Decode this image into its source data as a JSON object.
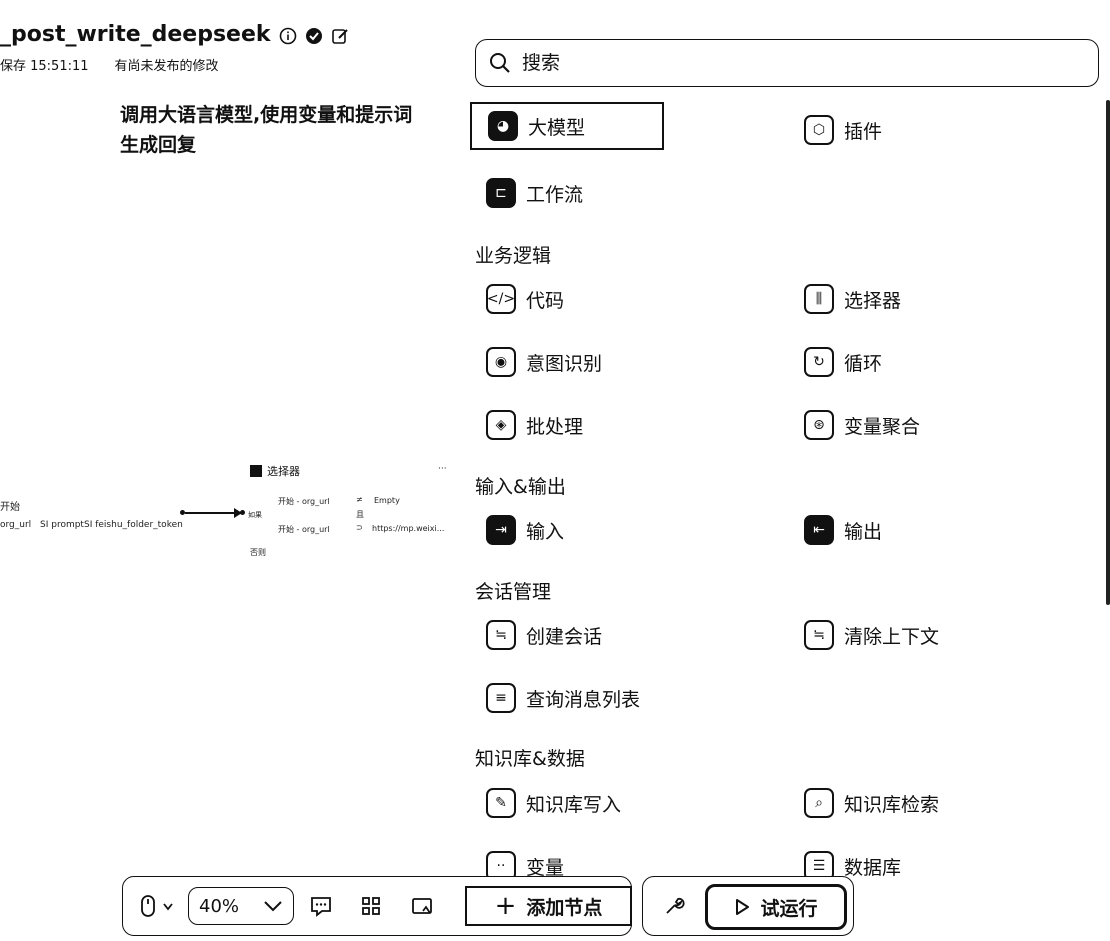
{
  "header": {
    "title": "_post_write_deepseek",
    "save_status": "保存 15:51:11",
    "unpublished": "有尚未发布的修改"
  },
  "tooltip": {
    "line1": "调用大语言模型,使用变量和提示词",
    "line2": "生成回复"
  },
  "canvas": {
    "start_label": "开始",
    "start_vars": [
      "org_url",
      "SI prompt",
      "SI feishu_folder_token"
    ],
    "selector_title": "选择器",
    "selector_if": "开始 - org_url",
    "selector_is_empty": "Empty",
    "selector_else_label": "否则",
    "selector_else": "开始 - org_url",
    "selector_compare": "https://mp.weixi...",
    "selector_side_marks": [
      "≠",
      "且",
      "⊃"
    ],
    "selector_more": "···",
    "port_label": "如果",
    "else_port": "否则"
  },
  "search": {
    "placeholder": "搜索"
  },
  "top_items": [
    {
      "label": "大模型",
      "icon": "llm-icon"
    },
    {
      "label": "插件",
      "icon": "plugin-icon"
    },
    {
      "label": "工作流",
      "icon": "workflow-icon"
    }
  ],
  "sections": [
    {
      "title": "业务逻辑",
      "items": [
        {
          "label": "代码",
          "icon": "code-icon"
        },
        {
          "label": "选择器",
          "icon": "selector-icon"
        },
        {
          "label": "意图识别",
          "icon": "intent-icon"
        },
        {
          "label": "循环",
          "icon": "loop-icon"
        },
        {
          "label": "批处理",
          "icon": "batch-icon"
        },
        {
          "label": "变量聚合",
          "icon": "variable-merge-icon"
        }
      ]
    },
    {
      "title": "输入&输出",
      "items": [
        {
          "label": "输入",
          "icon": "input-icon"
        },
        {
          "label": "输出",
          "icon": "output-icon"
        }
      ]
    },
    {
      "title": "会话管理",
      "items": [
        {
          "label": "创建会话",
          "icon": "create-session-icon"
        },
        {
          "label": "清除上下文",
          "icon": "clear-context-icon"
        },
        {
          "label": "查询消息列表",
          "icon": "message-list-icon"
        }
      ]
    },
    {
      "title": "知识库&数据",
      "items": [
        {
          "label": "知识库写入",
          "icon": "kb-write-icon"
        },
        {
          "label": "知识库检索",
          "icon": "kb-search-icon"
        },
        {
          "label": "变量",
          "icon": "variable-icon"
        },
        {
          "label": "数据库",
          "icon": "database-icon"
        }
      ]
    }
  ],
  "toolbar": {
    "zoom": "40%",
    "add_node": "添加节点",
    "test_run": "试运行"
  }
}
